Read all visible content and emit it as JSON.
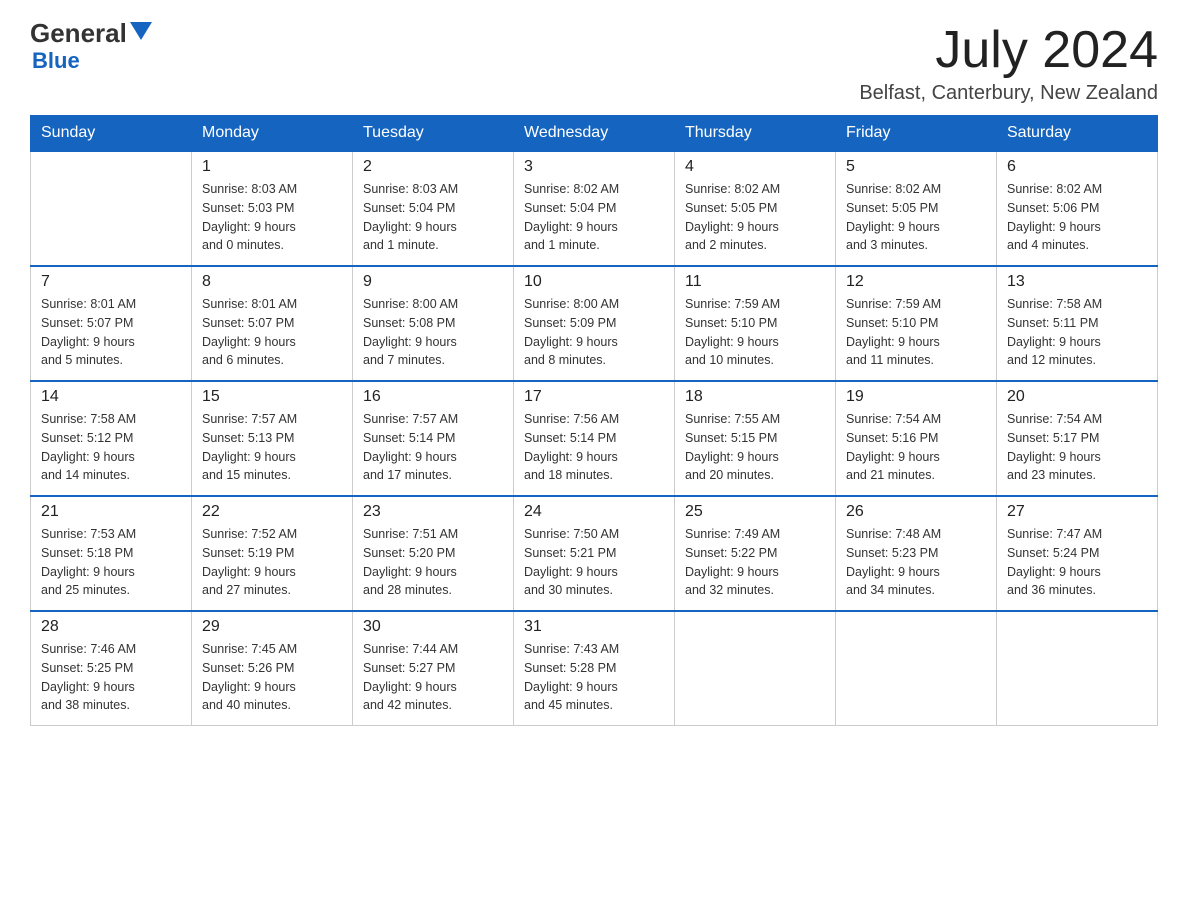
{
  "header": {
    "logo_general": "General",
    "logo_blue": "Blue",
    "month_year": "July 2024",
    "location": "Belfast, Canterbury, New Zealand"
  },
  "days_of_week": [
    "Sunday",
    "Monday",
    "Tuesday",
    "Wednesday",
    "Thursday",
    "Friday",
    "Saturday"
  ],
  "weeks": [
    {
      "days": [
        {
          "number": "",
          "info": ""
        },
        {
          "number": "1",
          "info": "Sunrise: 8:03 AM\nSunset: 5:03 PM\nDaylight: 9 hours\nand 0 minutes."
        },
        {
          "number": "2",
          "info": "Sunrise: 8:03 AM\nSunset: 5:04 PM\nDaylight: 9 hours\nand 1 minute."
        },
        {
          "number": "3",
          "info": "Sunrise: 8:02 AM\nSunset: 5:04 PM\nDaylight: 9 hours\nand 1 minute."
        },
        {
          "number": "4",
          "info": "Sunrise: 8:02 AM\nSunset: 5:05 PM\nDaylight: 9 hours\nand 2 minutes."
        },
        {
          "number": "5",
          "info": "Sunrise: 8:02 AM\nSunset: 5:05 PM\nDaylight: 9 hours\nand 3 minutes."
        },
        {
          "number": "6",
          "info": "Sunrise: 8:02 AM\nSunset: 5:06 PM\nDaylight: 9 hours\nand 4 minutes."
        }
      ]
    },
    {
      "days": [
        {
          "number": "7",
          "info": "Sunrise: 8:01 AM\nSunset: 5:07 PM\nDaylight: 9 hours\nand 5 minutes."
        },
        {
          "number": "8",
          "info": "Sunrise: 8:01 AM\nSunset: 5:07 PM\nDaylight: 9 hours\nand 6 minutes."
        },
        {
          "number": "9",
          "info": "Sunrise: 8:00 AM\nSunset: 5:08 PM\nDaylight: 9 hours\nand 7 minutes."
        },
        {
          "number": "10",
          "info": "Sunrise: 8:00 AM\nSunset: 5:09 PM\nDaylight: 9 hours\nand 8 minutes."
        },
        {
          "number": "11",
          "info": "Sunrise: 7:59 AM\nSunset: 5:10 PM\nDaylight: 9 hours\nand 10 minutes."
        },
        {
          "number": "12",
          "info": "Sunrise: 7:59 AM\nSunset: 5:10 PM\nDaylight: 9 hours\nand 11 minutes."
        },
        {
          "number": "13",
          "info": "Sunrise: 7:58 AM\nSunset: 5:11 PM\nDaylight: 9 hours\nand 12 minutes."
        }
      ]
    },
    {
      "days": [
        {
          "number": "14",
          "info": "Sunrise: 7:58 AM\nSunset: 5:12 PM\nDaylight: 9 hours\nand 14 minutes."
        },
        {
          "number": "15",
          "info": "Sunrise: 7:57 AM\nSunset: 5:13 PM\nDaylight: 9 hours\nand 15 minutes."
        },
        {
          "number": "16",
          "info": "Sunrise: 7:57 AM\nSunset: 5:14 PM\nDaylight: 9 hours\nand 17 minutes."
        },
        {
          "number": "17",
          "info": "Sunrise: 7:56 AM\nSunset: 5:14 PM\nDaylight: 9 hours\nand 18 minutes."
        },
        {
          "number": "18",
          "info": "Sunrise: 7:55 AM\nSunset: 5:15 PM\nDaylight: 9 hours\nand 20 minutes."
        },
        {
          "number": "19",
          "info": "Sunrise: 7:54 AM\nSunset: 5:16 PM\nDaylight: 9 hours\nand 21 minutes."
        },
        {
          "number": "20",
          "info": "Sunrise: 7:54 AM\nSunset: 5:17 PM\nDaylight: 9 hours\nand 23 minutes."
        }
      ]
    },
    {
      "days": [
        {
          "number": "21",
          "info": "Sunrise: 7:53 AM\nSunset: 5:18 PM\nDaylight: 9 hours\nand 25 minutes."
        },
        {
          "number": "22",
          "info": "Sunrise: 7:52 AM\nSunset: 5:19 PM\nDaylight: 9 hours\nand 27 minutes."
        },
        {
          "number": "23",
          "info": "Sunrise: 7:51 AM\nSunset: 5:20 PM\nDaylight: 9 hours\nand 28 minutes."
        },
        {
          "number": "24",
          "info": "Sunrise: 7:50 AM\nSunset: 5:21 PM\nDaylight: 9 hours\nand 30 minutes."
        },
        {
          "number": "25",
          "info": "Sunrise: 7:49 AM\nSunset: 5:22 PM\nDaylight: 9 hours\nand 32 minutes."
        },
        {
          "number": "26",
          "info": "Sunrise: 7:48 AM\nSunset: 5:23 PM\nDaylight: 9 hours\nand 34 minutes."
        },
        {
          "number": "27",
          "info": "Sunrise: 7:47 AM\nSunset: 5:24 PM\nDaylight: 9 hours\nand 36 minutes."
        }
      ]
    },
    {
      "days": [
        {
          "number": "28",
          "info": "Sunrise: 7:46 AM\nSunset: 5:25 PM\nDaylight: 9 hours\nand 38 minutes."
        },
        {
          "number": "29",
          "info": "Sunrise: 7:45 AM\nSunset: 5:26 PM\nDaylight: 9 hours\nand 40 minutes."
        },
        {
          "number": "30",
          "info": "Sunrise: 7:44 AM\nSunset: 5:27 PM\nDaylight: 9 hours\nand 42 minutes."
        },
        {
          "number": "31",
          "info": "Sunrise: 7:43 AM\nSunset: 5:28 PM\nDaylight: 9 hours\nand 45 minutes."
        },
        {
          "number": "",
          "info": ""
        },
        {
          "number": "",
          "info": ""
        },
        {
          "number": "",
          "info": ""
        }
      ]
    }
  ]
}
